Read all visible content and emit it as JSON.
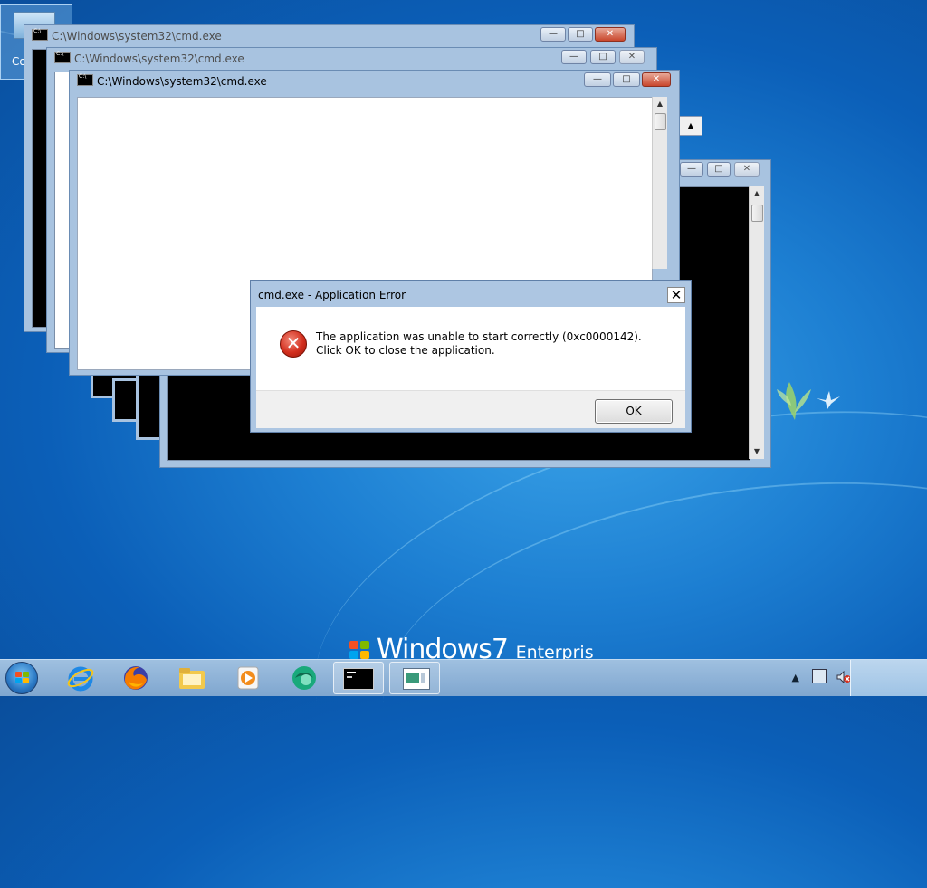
{
  "desktop": {
    "icon_label": "Co",
    "watermark": {
      "brand": "Windows",
      "version": "7",
      "edition": "Enterprise"
    }
  },
  "windows": [
    {
      "id": "cmd1",
      "title": "C:\\Windows\\system32\\cmd.exe",
      "state": "inactive"
    },
    {
      "id": "cmd2",
      "title": "C:\\Windows\\system32\\cmd.exe",
      "state": "inactive"
    },
    {
      "id": "cmd3",
      "title": "C:\\Windows\\system32\\cmd.exe",
      "state": "active"
    }
  ],
  "window_controls": {
    "minimize": "—",
    "maximize": "□",
    "close": "✕"
  },
  "dialog": {
    "title": "cmd.exe - Application Error",
    "icon": "error-icon",
    "message": "The application was unable to start correctly (0xc0000142). Click OK to close the application.",
    "ok_label": "OK",
    "close_glyph": "✕"
  },
  "taskbar": {
    "pinned": [
      "internet-explorer-icon",
      "firefox-icon",
      "file-explorer-icon",
      "media-player-icon",
      "app-icon"
    ],
    "running": [
      "cmd-icon",
      "window-icon"
    ],
    "tray_arrow": "▲"
  },
  "colors": {
    "close_red": "#c9462c",
    "error_red": "#d32f1e",
    "desktop_blue": "#1d7fd2"
  }
}
